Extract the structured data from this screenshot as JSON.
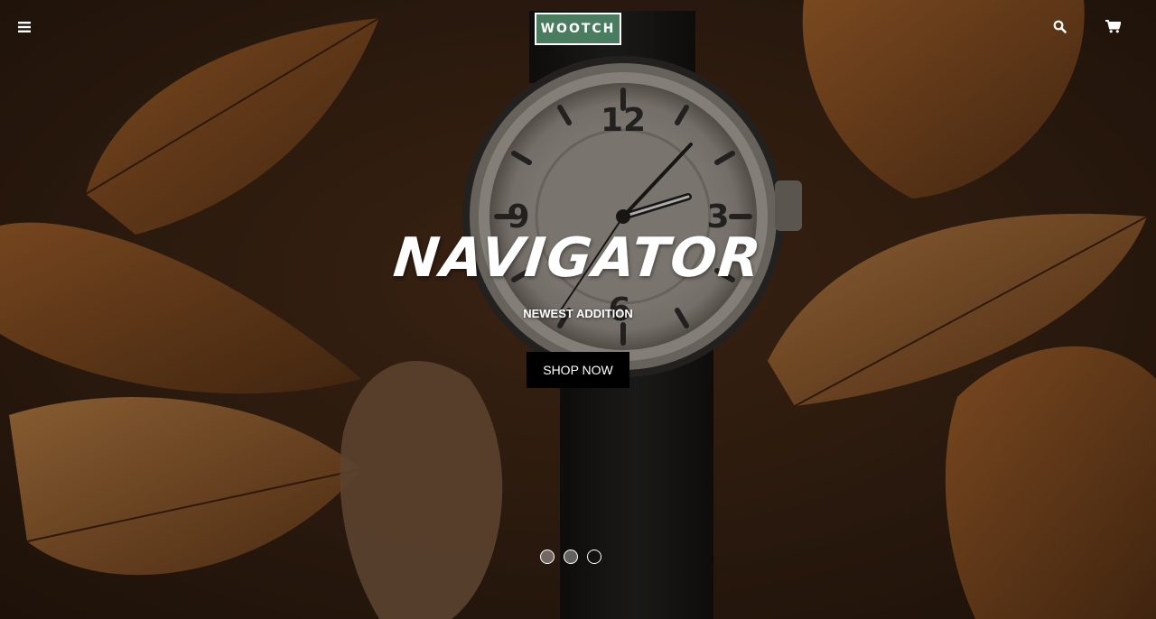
{
  "header": {
    "logo_text": "WOOTCH",
    "menu_icon": "hamburger-icon",
    "search_icon": "search-icon",
    "cart_icon": "cart-icon"
  },
  "hero": {
    "title": "NAVIGATOR",
    "subtitle": "NEWEST ADDITION",
    "cta_label": "SHOP NOW",
    "image_subject": "wristwatch on dry autumn leaves"
  },
  "carousel": {
    "slide_count": 3,
    "active_index": 2
  },
  "colors": {
    "logo_bg": "#4a7c5f",
    "cta_bg": "#000000",
    "text": "#ffffff",
    "background": "#3a2414"
  }
}
